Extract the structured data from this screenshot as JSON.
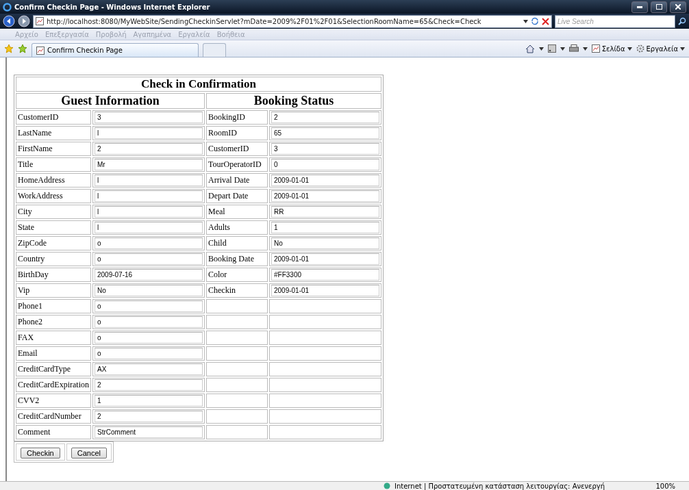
{
  "window": {
    "title": "Confirm Checkin Page - Windows Internet Explorer"
  },
  "address": {
    "url": "http://localhost:8080/MyWebSite/SendingCheckinServlet?mDate=2009%2F01%2F01&SelectionRoomName=65&Check=Check",
    "search_placeholder": "Live Search"
  },
  "menu": [
    "Αρχείο",
    "Επεξεργασία",
    "Προβολή",
    "Αγαπημένα",
    "Εργαλεία",
    "Βοήθεια"
  ],
  "tab": {
    "title": "Confirm Checkin Page"
  },
  "commands": {
    "page": "Σελίδα",
    "tools": "Εργαλεία"
  },
  "form": {
    "title": "Check in Confirmation",
    "guest_header": "Guest Information",
    "booking_header": "Booking Status",
    "guest": [
      {
        "label": "CustomerID",
        "value": "3"
      },
      {
        "label": "LastName",
        "value": "l"
      },
      {
        "label": "FirstName",
        "value": "2"
      },
      {
        "label": "Title",
        "value": "Mr"
      },
      {
        "label": "HomeAddress",
        "value": "l"
      },
      {
        "label": "WorkAddress",
        "value": "l"
      },
      {
        "label": "City",
        "value": "l"
      },
      {
        "label": "State",
        "value": "l"
      },
      {
        "label": "ZipCode",
        "value": "o"
      },
      {
        "label": "Country",
        "value": "o"
      },
      {
        "label": "BirthDay",
        "value": "2009-07-16"
      },
      {
        "label": "Vip",
        "value": "No"
      },
      {
        "label": "Phone1",
        "value": "o"
      },
      {
        "label": "Phone2",
        "value": "o"
      },
      {
        "label": "FAX",
        "value": "o"
      },
      {
        "label": "Email",
        "value": "o"
      },
      {
        "label": "CreditCardType",
        "value": "AX"
      },
      {
        "label": "CreditCardExpiration",
        "value": "2"
      },
      {
        "label": "CVV2",
        "value": "1"
      },
      {
        "label": "CreditCardNumber",
        "value": "2"
      },
      {
        "label": "Comment",
        "value": "StrComment"
      }
    ],
    "booking": [
      {
        "label": "BookingID",
        "value": "2"
      },
      {
        "label": "RoomID",
        "value": "65"
      },
      {
        "label": "CustomerID",
        "value": "3"
      },
      {
        "label": "TourOperatorID",
        "value": "0"
      },
      {
        "label": "Arrival Date",
        "value": "2009-01-01"
      },
      {
        "label": "Depart Date",
        "value": "2009-01-01"
      },
      {
        "label": "Meal",
        "value": "RR"
      },
      {
        "label": "Adults",
        "value": "1"
      },
      {
        "label": "Child",
        "value": "No"
      },
      {
        "label": "Booking Date",
        "value": "2009-01-01"
      },
      {
        "label": "Color",
        "value": "#FF3300"
      },
      {
        "label": "Checkin",
        "value": "2009-01-01"
      }
    ],
    "buttons": [
      "Checkin",
      "Cancel"
    ]
  },
  "status_bar": {
    "zone": "Internet | Προστατευμένη κατάσταση λειτουργίας: Ανενεργή",
    "zoom": "100%"
  }
}
